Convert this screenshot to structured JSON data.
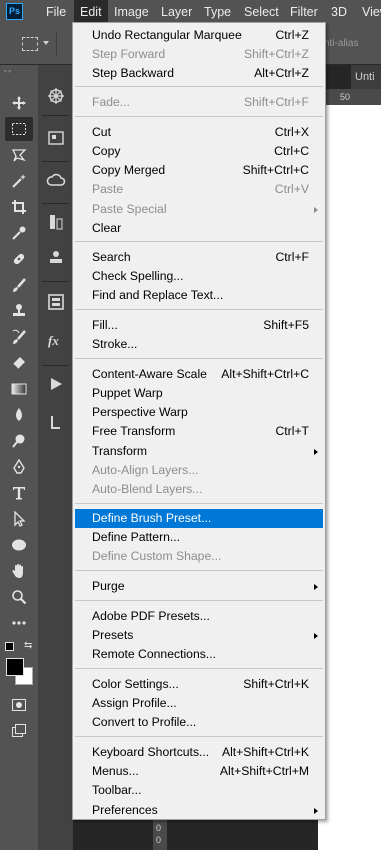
{
  "app": {
    "logo_text": "Ps"
  },
  "menubar": {
    "items": [
      "File",
      "Edit",
      "Image",
      "Layer",
      "Type",
      "Select",
      "Filter",
      "3D",
      "View"
    ]
  },
  "options_bar": {
    "anti_alias_label": "nti-alias"
  },
  "document": {
    "tab_label": "Unti",
    "ruler_marks": [
      "50",
      "0",
      "0",
      "0"
    ]
  },
  "edit_menu": {
    "items": [
      {
        "label": "Undo Rectangular Marquee",
        "shortcut": "Ctrl+Z"
      },
      {
        "label": "Step Forward",
        "shortcut": "Shift+Ctrl+Z",
        "disabled": true
      },
      {
        "label": "Step Backward",
        "shortcut": "Alt+Ctrl+Z"
      },
      {
        "label": "Fade...",
        "shortcut": "Shift+Ctrl+F",
        "disabled": true
      },
      {
        "label": "Cut",
        "shortcut": "Ctrl+X"
      },
      {
        "label": "Copy",
        "shortcut": "Ctrl+C"
      },
      {
        "label": "Copy Merged",
        "shortcut": "Shift+Ctrl+C"
      },
      {
        "label": "Paste",
        "shortcut": "Ctrl+V",
        "disabled": true
      },
      {
        "label": "Paste Special",
        "submenu": true,
        "disabled": true
      },
      {
        "label": "Clear",
        "shortcut": ""
      },
      {
        "label": "Search",
        "shortcut": "Ctrl+F"
      },
      {
        "label": "Check Spelling...",
        "shortcut": ""
      },
      {
        "label": "Find and Replace Text...",
        "shortcut": ""
      },
      {
        "label": "Fill...",
        "shortcut": "Shift+F5"
      },
      {
        "label": "Stroke...",
        "shortcut": ""
      },
      {
        "label": "Content-Aware Scale",
        "shortcut": "Alt+Shift+Ctrl+C"
      },
      {
        "label": "Puppet Warp",
        "shortcut": ""
      },
      {
        "label": "Perspective Warp",
        "shortcut": ""
      },
      {
        "label": "Free Transform",
        "shortcut": "Ctrl+T"
      },
      {
        "label": "Transform",
        "submenu": true
      },
      {
        "label": "Auto-Align Layers...",
        "disabled": true
      },
      {
        "label": "Auto-Blend Layers...",
        "disabled": true
      },
      {
        "label": "Define Brush Preset...",
        "highlighted": true
      },
      {
        "label": "Define Pattern..."
      },
      {
        "label": "Define Custom Shape...",
        "disabled": true
      },
      {
        "label": "Purge",
        "submenu": true
      },
      {
        "label": "Adobe PDF Presets..."
      },
      {
        "label": "Presets",
        "submenu": true
      },
      {
        "label": "Remote Connections..."
      },
      {
        "label": "Color Settings...",
        "shortcut": "Shift+Ctrl+K"
      },
      {
        "label": "Assign Profile..."
      },
      {
        "label": "Convert to Profile..."
      },
      {
        "label": "Keyboard Shortcuts...",
        "shortcut": "Alt+Shift+Ctrl+K"
      },
      {
        "label": "Menus...",
        "shortcut": "Alt+Shift+Ctrl+M"
      },
      {
        "label": "Toolbar..."
      },
      {
        "label": "Preferences",
        "submenu": true
      }
    ]
  },
  "colors": {
    "menubar_bg": "#535353",
    "menu_bg": "#f0f0f0",
    "highlight": "#0078d7",
    "disabled_text": "#8d8d8d",
    "foreground_color": "#000000",
    "background_color": "#ffffff"
  },
  "toolbar_icons": [
    "move-icon",
    "rectangular-marquee-icon",
    "lasso-icon",
    "magic-wand-icon",
    "crop-icon",
    "eyedropper-icon",
    "healing-brush-icon",
    "brush-icon",
    "clone-stamp-icon",
    "history-brush-icon",
    "eraser-icon",
    "gradient-icon",
    "blur-icon",
    "dodge-icon",
    "pen-icon",
    "type-icon",
    "path-selection-icon",
    "ellipse-icon",
    "hand-icon",
    "zoom-icon",
    "more-tools-icon"
  ]
}
